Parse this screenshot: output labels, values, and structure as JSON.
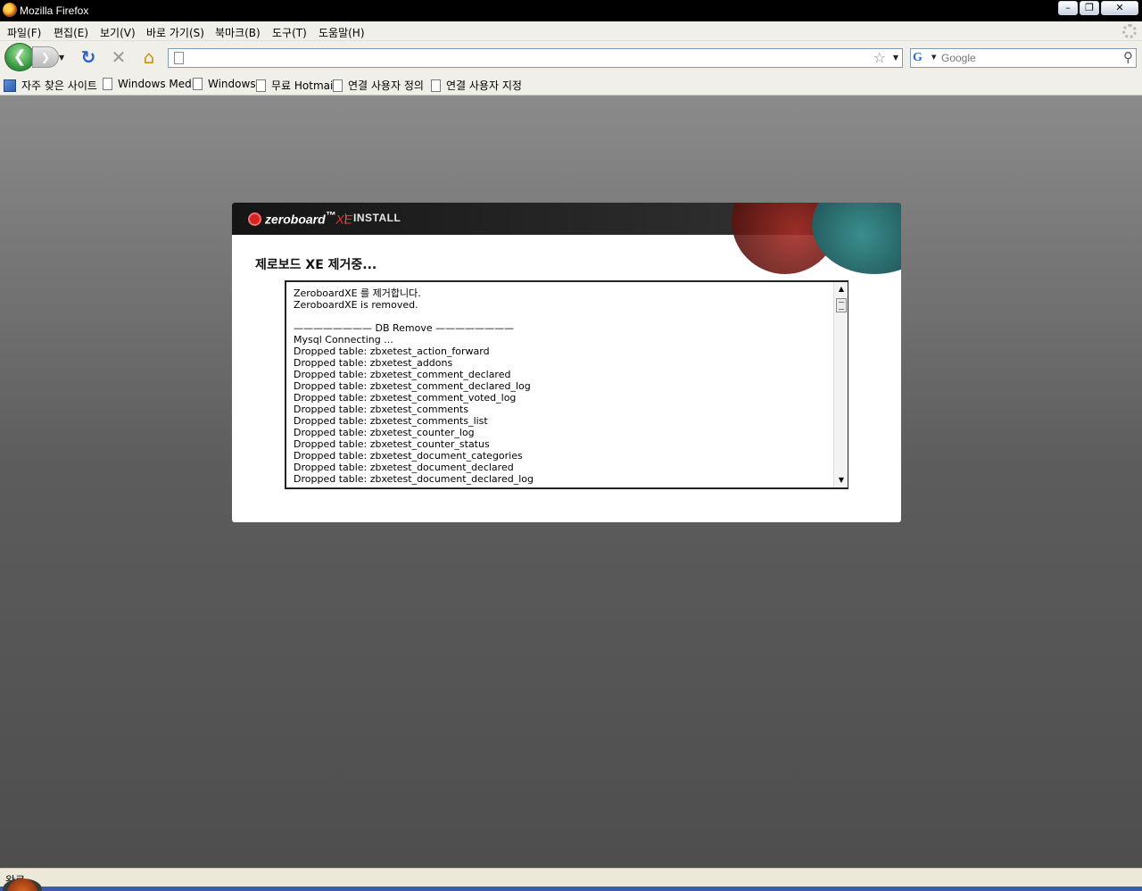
{
  "window": {
    "title": "Mozilla Firefox",
    "minimize": "–",
    "restore": "❐",
    "close": "✕"
  },
  "menu": [
    "파일(F)",
    "편집(E)",
    "보기(V)",
    "바로 가기(S)",
    "북마크(B)",
    "도구(T)",
    "도움말(H)"
  ],
  "nav": {
    "back": "❮",
    "forward": "❯",
    "reload": "↻",
    "stop": "✕",
    "home": "⌂",
    "url_value": "",
    "star": "☆",
    "search_engine": "G",
    "search_placeholder": "Google",
    "search_go": "⚲"
  },
  "bookmarks": [
    "자주 찾은 사이트",
    "Windows Media",
    "Windows",
    "무료 Hotmail",
    "연결 사용자 정의",
    "연결 사용자 지정"
  ],
  "panel": {
    "logo_text": "zeroboard",
    "logo_xe": "XE",
    "header_label": "INSTALL",
    "title": "제로보드 XE 제거중...",
    "log": [
      "ZeroboardXE 를 제거합니다.",
      "ZeroboardXE is removed.",
      "",
      "———————— DB Remove ————————",
      "Mysql Connecting ...",
      "Dropped table: zbxetest_action_forward",
      "Dropped table: zbxetest_addons",
      "Dropped table: zbxetest_comment_declared",
      "Dropped table: zbxetest_comment_declared_log",
      "Dropped table: zbxetest_comment_voted_log",
      "Dropped table: zbxetest_comments",
      "Dropped table: zbxetest_comments_list",
      "Dropped table: zbxetest_counter_log",
      "Dropped table: zbxetest_counter_status",
      "Dropped table: zbxetest_document_categories",
      "Dropped table: zbxetest_document_declared",
      "Dropped table: zbxetest_document_declared_log"
    ]
  },
  "status": {
    "text": "완료"
  }
}
